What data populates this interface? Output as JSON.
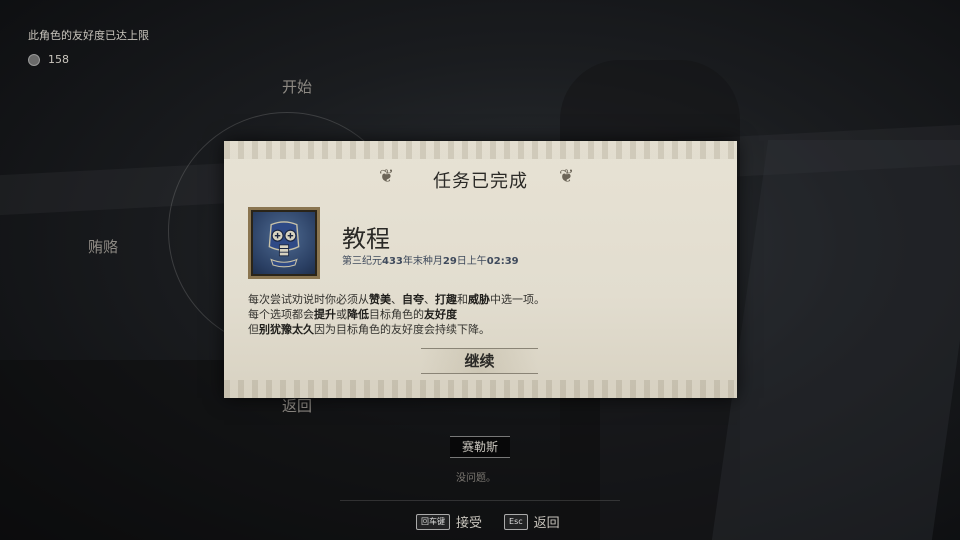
{
  "hud": {
    "notice": "此角色的友好度已达上限",
    "currency_icon": "coin-icon",
    "currency_value": "158"
  },
  "dialogue_wheel": {
    "options": [
      "开始",
      "贿赂",
      "返回"
    ]
  },
  "dialog": {
    "title": "任务已完成",
    "quest_icon": "tutorial-mask-icon",
    "quest_name": "教程",
    "date_prefix": "第三纪元",
    "date_year": "433",
    "date_mid": "年末种月",
    "date_day": "29",
    "date_ampm": "日上午",
    "date_time": "02:39",
    "desc": {
      "l1a": "每次尝试劝说时你必须从",
      "l1b": "赞美",
      "l1c": "、",
      "l1d": "自夸",
      "l1e": "、",
      "l1f": "打趣",
      "l1g": "和",
      "l1h": "威胁",
      "l1i": "中选一项。",
      "l2a": "每个选项都会",
      "l2b": "提升",
      "l2c": "或",
      "l2d": "降低",
      "l2e": "目标角色的",
      "l2f": "友好度",
      "l3a": "但",
      "l3b": "别犹豫太久",
      "l3c": "因为目标角色的友好度会持续下降。"
    },
    "continue_label": "继续"
  },
  "npc": {
    "name": "赛勒斯",
    "subtitle": "没问题。"
  },
  "keyhints": {
    "accept_key": "回车键",
    "accept_label": "接受",
    "back_key": "Esc",
    "back_label": "返回"
  }
}
